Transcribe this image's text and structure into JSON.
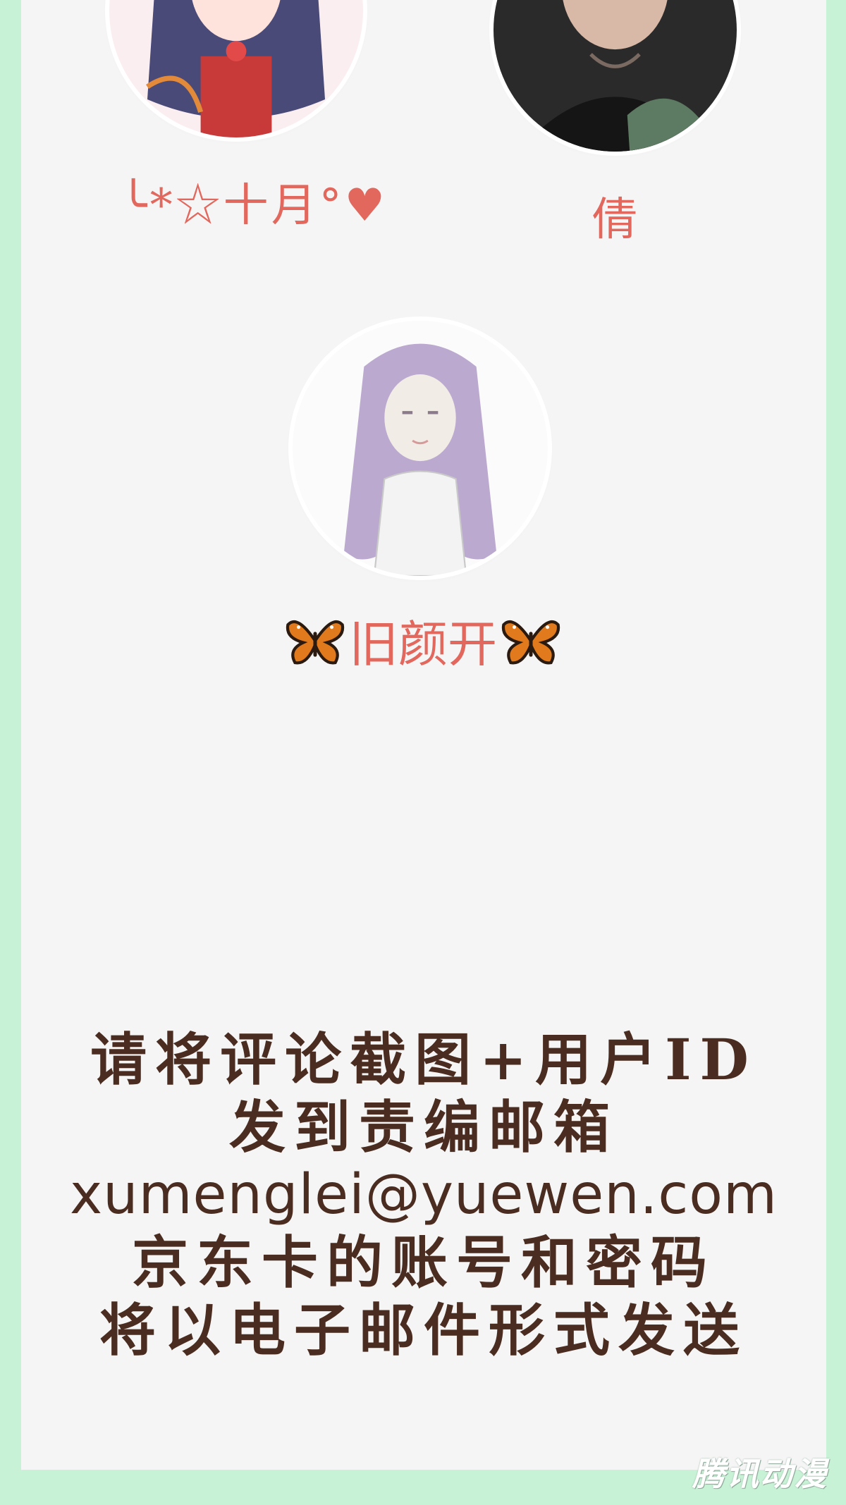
{
  "users": [
    {
      "name": "╰*☆十月°♥",
      "avatar_icon": "anime-girl-avatar-icon"
    },
    {
      "name": "倩",
      "avatar_icon": "photo-avatar-icon"
    },
    {
      "name": "旧颜开",
      "avatar_icon": "anime-girl-lavender-avatar-icon",
      "decor_icon": "butterfly-icon"
    }
  ],
  "notice": {
    "lines": [
      "请将评论截图+用户ID",
      "发到责编邮箱",
      "xumenglei@yuewen.com",
      "京东卡的账号和密码",
      "将以电子邮件形式发送"
    ]
  },
  "watermark": "腾讯动漫",
  "colors": {
    "background_green": "#c8f2d6",
    "panel": "#f5f5f5",
    "name_red": "#e2675d",
    "notice_brown": "#4a2d20"
  }
}
